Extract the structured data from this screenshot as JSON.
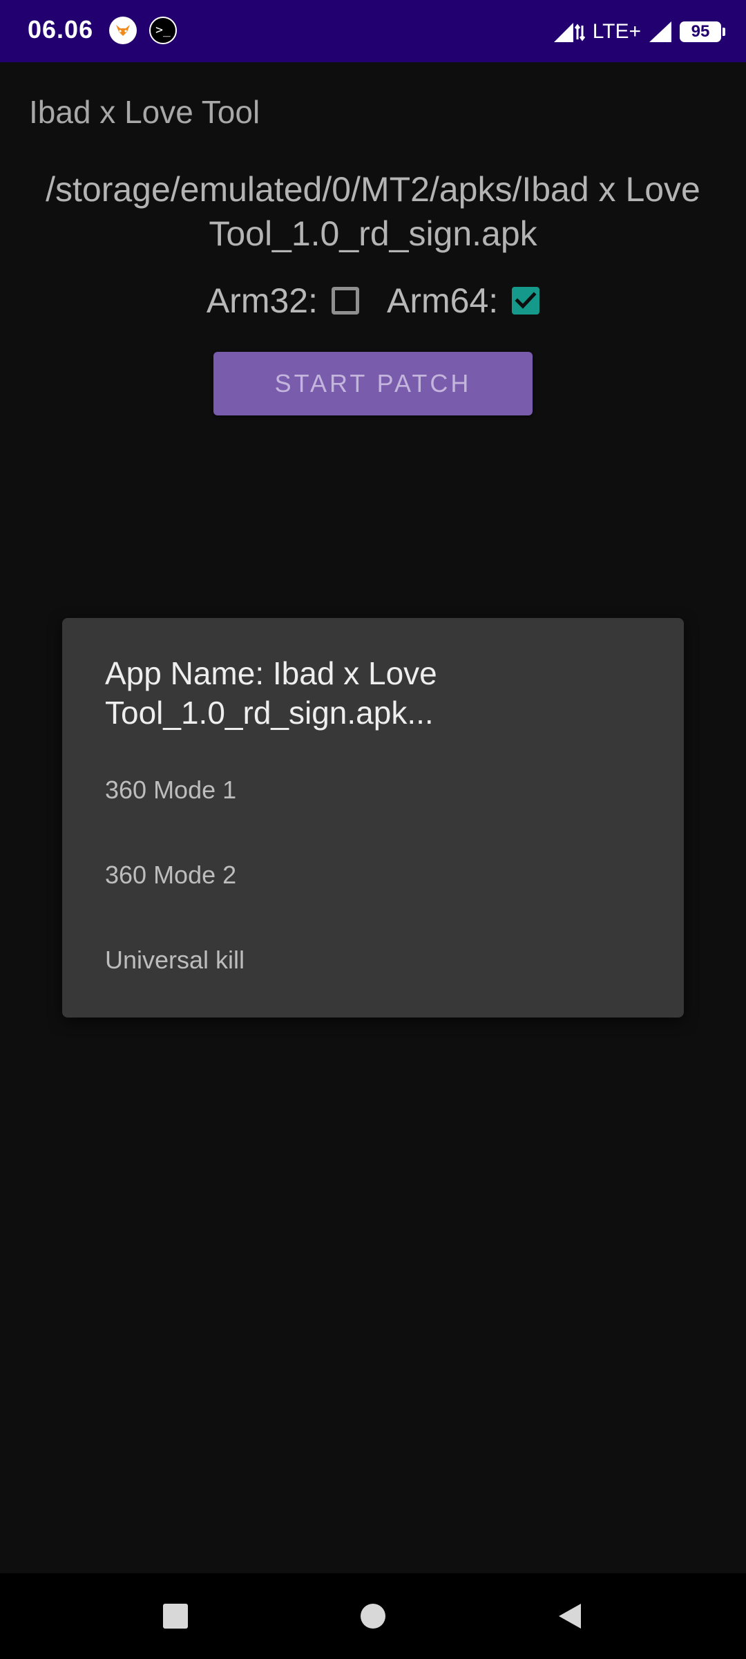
{
  "status_bar": {
    "time": "06.06",
    "network": "LTE+",
    "battery_level": "95",
    "icons": [
      "fox-app-icon",
      "terminal-app-icon",
      "signal-icon",
      "signal-icon"
    ]
  },
  "app": {
    "title": "Ibad x Love Tool"
  },
  "main": {
    "path": "/storage/emulated/0/MT2/apks/Ibad x Love Tool_1.0_rd_sign.apk",
    "arm32_label": "Arm32:",
    "arm32_checked": false,
    "arm64_label": "Arm64:",
    "arm64_checked": true,
    "start_button": "START PATCH"
  },
  "dialog": {
    "title": "App Name: Ibad x Love Tool_1.0_rd_sign.apk...",
    "items": [
      {
        "label": "360 Mode 1"
      },
      {
        "label": "360 Mode 2"
      },
      {
        "label": "Universal kill"
      }
    ]
  },
  "nav_bar": {
    "buttons": [
      "recents",
      "home",
      "back"
    ]
  },
  "colors": {
    "status_bar": "#23006f",
    "background": "#0e0e0e",
    "button": "#7a5cad",
    "checkbox_accent": "#14998a",
    "dialog": "#383838"
  }
}
